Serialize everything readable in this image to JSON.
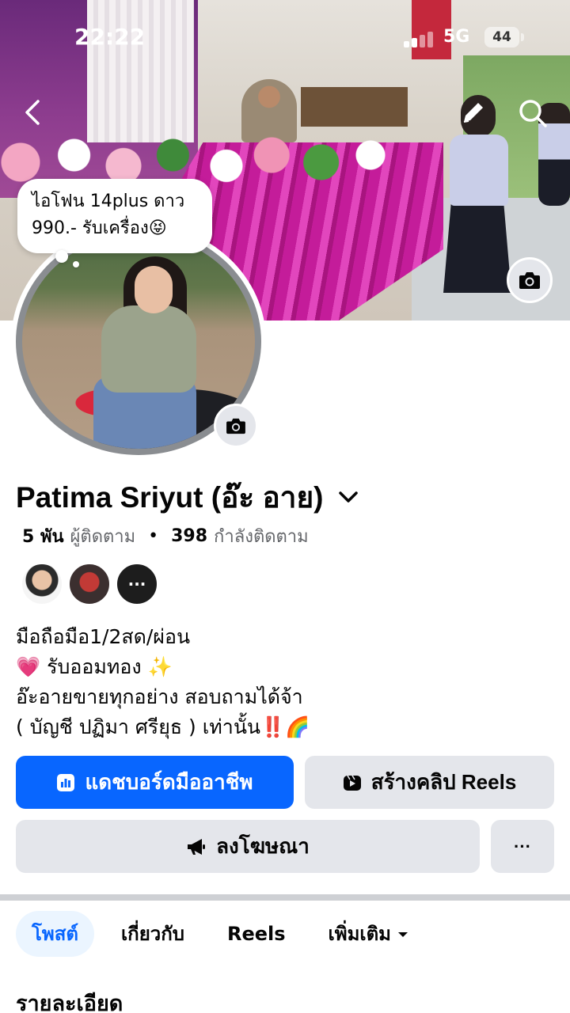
{
  "status_bar": {
    "time": "22:22",
    "network": "5G",
    "battery": "44"
  },
  "note": {
    "text_line1": "ไอโฟน 14plus ดาว",
    "text_line2": "990.- รับเครื่อง😝"
  },
  "profile": {
    "name": "Patima Sriyut (อ๊ะ อาย)",
    "followers_count": "5 พัน",
    "followers_label": "ผู้ติดตาม",
    "following_count": "398",
    "following_label": "กำลังติดตาม",
    "mutual_more": "···"
  },
  "bio": {
    "line1": "มือถือมือ1/2สด/ผ่อน",
    "line2": "💗 รับออมทอง ✨",
    "line3": "อ๊ะอายขายทุกอย่าง สอบถามได้จ้า",
    "line4": "( บัญชี ปฏิมา ศรียุธ ) เท่านั้น‼️🌈"
  },
  "actions": {
    "dashboard": "แดชบอร์ดมืออาชีพ",
    "create_reels": "สร้างคลิป Reels",
    "advertise": "ลงโฆษณา",
    "more": "···"
  },
  "tabs": [
    {
      "label": "โพสต์",
      "active": true
    },
    {
      "label": "เกี่ยวกับ",
      "active": false
    },
    {
      "label": "Reels",
      "active": false
    },
    {
      "label": "เพิ่มเติม",
      "active": false
    }
  ],
  "section": {
    "details_title": "รายละเอียด"
  },
  "colors": {
    "accent": "#0866ff",
    "button_gray": "#e4e6eb",
    "tab_active_bg": "#ebf5ff",
    "text_secondary": "#65676b"
  },
  "icons": [
    "back-icon",
    "edit-icon",
    "search-icon",
    "camera-icon",
    "chevron-down-icon",
    "dashboard-icon",
    "reels-icon",
    "megaphone-icon",
    "caret-down-icon"
  ]
}
